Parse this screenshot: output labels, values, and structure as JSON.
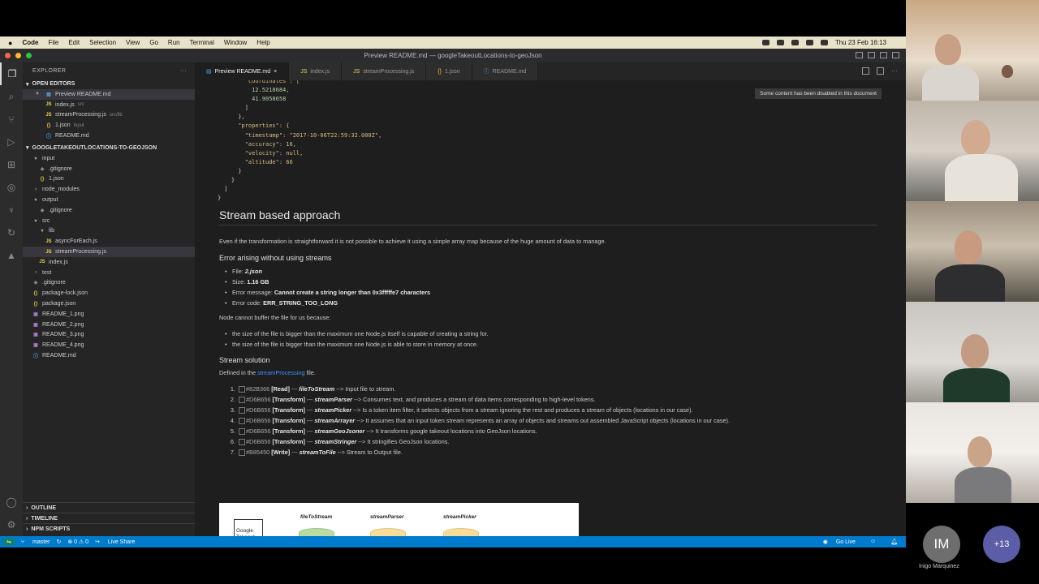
{
  "menubar": {
    "apple": "",
    "app": "Code",
    "items": [
      "File",
      "Edit",
      "Selection",
      "View",
      "Go",
      "Run",
      "Terminal",
      "Window",
      "Help"
    ],
    "clock": "Thu 23 Feb  16:13"
  },
  "window": {
    "title": "Preview README.md — googleTakeoutLocations-to-geoJson"
  },
  "sidebar": {
    "title": "EXPLORER",
    "open_editors": "OPEN EDITORS",
    "open_files": [
      {
        "icon": "md",
        "name": "Preview README.md",
        "desc": ""
      },
      {
        "icon": "JS",
        "name": "index.js",
        "desc": "src"
      },
      {
        "icon": "JS",
        "name": "streamProcessing.js",
        "desc": "src/lib"
      },
      {
        "icon": "{}",
        "name": "1.json",
        "desc": "input"
      },
      {
        "icon": "md",
        "name": "README.md",
        "desc": ""
      }
    ],
    "project": "GOOGLETAKEOUTLOCATIONS-TO-GEOJSON",
    "tree": [
      {
        "icon": "▾",
        "name": "input",
        "indent": 1
      },
      {
        "icon": "◆",
        "name": ".gitignore",
        "indent": 2
      },
      {
        "icon": "{}",
        "name": "1.json",
        "indent": 2
      },
      {
        "icon": "›",
        "name": "node_modules",
        "indent": 1
      },
      {
        "icon": "▾",
        "name": "output",
        "indent": 1
      },
      {
        "icon": "◆",
        "name": ".gitignore",
        "indent": 2
      },
      {
        "icon": "▾",
        "name": "src",
        "indent": 1
      },
      {
        "icon": "▾",
        "name": "lib",
        "indent": 2
      },
      {
        "icon": "JS",
        "name": "asyncForEach.js",
        "indent": 3
      },
      {
        "icon": "JS",
        "name": "streamProcessing.js",
        "indent": 3
      },
      {
        "icon": "JS",
        "name": "index.js",
        "indent": 2
      },
      {
        "icon": "›",
        "name": "test",
        "indent": 1
      },
      {
        "icon": "◆",
        "name": ".gitignore",
        "indent": 1
      },
      {
        "icon": "{}",
        "name": "package-lock.json",
        "indent": 1
      },
      {
        "icon": "{}",
        "name": "package.json",
        "indent": 1
      },
      {
        "icon": "▣",
        "name": "README_1.png",
        "indent": 1
      },
      {
        "icon": "▣",
        "name": "README_2.png",
        "indent": 1
      },
      {
        "icon": "▣",
        "name": "README_3.png",
        "indent": 1
      },
      {
        "icon": "▣",
        "name": "README_4.png",
        "indent": 1
      },
      {
        "icon": "ⓘ",
        "name": "README.md",
        "indent": 1
      }
    ],
    "outline": "OUTLINE",
    "timeline": "TIMELINE",
    "npm": "NPM SCRIPTS"
  },
  "tabs": [
    {
      "label": "Preview README.md",
      "close": "×"
    },
    {
      "label": "index.js"
    },
    {
      "label": "streamProcessing.js"
    },
    {
      "label": "1.json"
    },
    {
      "label": "README.md"
    }
  ],
  "preview": {
    "notice": "Some content has been disabled in this document",
    "code_lines": [
      "        \"coordinates\": [",
      "          12.5218684,",
      "          41.9058658",
      "        ]",
      "      },",
      "      \"properties\": {",
      "        \"timestamp\": \"2017-10-06T22:59:32.000Z\",",
      "        \"accuracy\": 16,",
      "        \"velocity\": null,",
      "        \"altitude\": 66",
      "      }",
      "    }",
      "  ]",
      "}"
    ],
    "h2": "Stream based approach",
    "intro": "Even if the transformation is straightforward it is not possible to achieve it using a simple array map because of the huge amount of data to manage.",
    "h3_error": "Error arising without using streams",
    "errors": [
      {
        "label": "File: ",
        "value": "2.json",
        "italic": true
      },
      {
        "label": "Size: ",
        "value": "1.16 GB"
      },
      {
        "label": "Error message: ",
        "value": "Cannot create a string longer than 0x3fffffe7 characters"
      },
      {
        "label": "Error code: ",
        "value": "ERR_STRING_TOO_LONG"
      }
    ],
    "node_cannot": "Node cannot buffer the file for us because:",
    "reasons": [
      "the size of the file is bigger than the maximum one Node.js itself is capable of creating a string for.",
      "the size of the file is bigger than the maximum one Node.js is able to store in memory at once."
    ],
    "h3_solution": "Stream solution",
    "defined_pre": "Defined in the ",
    "defined_link": "streamProcessing",
    "defined_post": " file.",
    "steps": [
      {
        "num": "1.",
        "color": "#82B366",
        "kind": "[Read]",
        "name": "fileToStream",
        "desc": " --> Input file to stream."
      },
      {
        "num": "2.",
        "color": "#D6B656",
        "kind": "[Transform]",
        "name": "streamParser",
        "desc": " --> Consumes text, and produces a stream of data items corresponding to high-level tokens."
      },
      {
        "num": "3.",
        "color": "#D6B656",
        "kind": "[Transform]",
        "name": "streamPicker",
        "desc": " --> Is a token item filter, it selects objects from a stream ignoring the rest and produces a stream of objects (locations in our case)."
      },
      {
        "num": "4.",
        "color": "#D6B656",
        "kind": "[Transform]",
        "name": "streamArrayer",
        "desc": " --> It assumes that an input token stream represents an array of objects and streams out assembled JavaScript objects (locations in our case)."
      },
      {
        "num": "5.",
        "color": "#D6B656",
        "kind": "[Transform]",
        "name": "streamGeoJsoner",
        "desc": " --> It transforms google takeout locations into GeoJson locations."
      },
      {
        "num": "6.",
        "color": "#D6B656",
        "kind": "[Transform]",
        "name": "streamStringer",
        "desc": " --> It stringifies GeoJson locations."
      },
      {
        "num": "7.",
        "color": "#B85450",
        "kind": "[Write]",
        "name": "streamToFile",
        "desc": " --> Stream to Output file."
      }
    ],
    "diagram": {
      "doc": "Google Takeout Locations json",
      "labels": [
        "fileToStream",
        "streamParser",
        "streamPicker"
      ]
    }
  },
  "statusbar": {
    "branch": "master",
    "errors": "⊗ 0 ⚠ 0",
    "liveshare": "Live Share",
    "golive": "Go Live"
  },
  "participants": {
    "initials": "IM",
    "name": "Inigo Marquinez",
    "more": "+13"
  }
}
